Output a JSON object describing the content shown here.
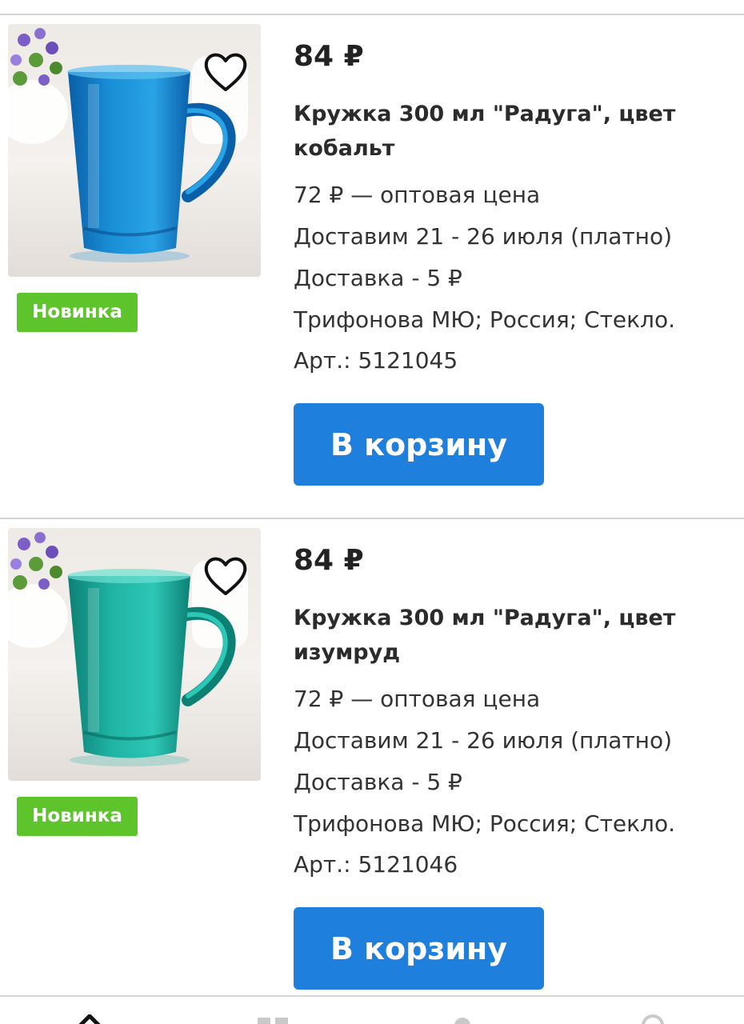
{
  "products": [
    {
      "price": "84 ₽",
      "title": "Кружка 300 мл \"Радуга\", цвет кобальт",
      "wholesale": "72 ₽ — оптовая цена",
      "delivery_date": "Доставим 21 - 26 июля (платно)",
      "delivery_cost": "Доставка - 5 ₽",
      "attributes": "Трифонова МЮ; Россия; Стекло.",
      "article": "Арт.: 5121045",
      "badge": "Новинка",
      "cart_label": "В корзину",
      "mug_color": "#1a8fd6",
      "mug_color_dark": "#0a5fa8",
      "favorite_icon": "heart-outline-icon"
    },
    {
      "price": "84 ₽",
      "title": "Кружка 300 мл \"Радуга\", цвет изумруд",
      "wholesale": "72 ₽ — оптовая цена",
      "delivery_date": "Доставим 21 - 26 июля (платно)",
      "delivery_cost": "Доставка - 5 ₽",
      "attributes": "Трифонова МЮ; Россия; Стекло.",
      "article": "Арт.: 5121046",
      "badge": "Новинка",
      "cart_label": "В корзину",
      "mug_color": "#1fb3a3",
      "mug_color_dark": "#0d8074",
      "favorite_icon": "heart-outline-icon"
    }
  ],
  "colors": {
    "badge": "#5ec42c",
    "button": "#1e80dc",
    "divider": "#d6d6d6"
  },
  "bottom_nav": {
    "icons": [
      "home-icon",
      "catalog-icon",
      "cart-icon",
      "profile-icon"
    ]
  }
}
